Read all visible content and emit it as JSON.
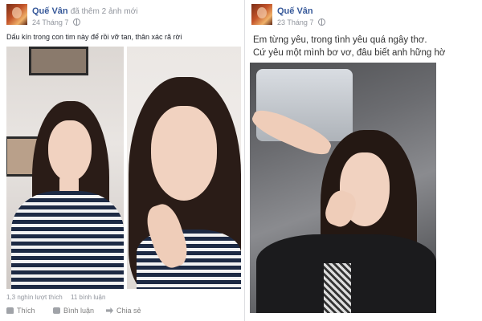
{
  "post_left": {
    "author": "Quế Vân",
    "extra_text": "đã thêm 2 ảnh mới",
    "date": "24 Tháng 7",
    "caption": "Dấu kín trong con tim này để rồi vỡ tan, thân xác rã rời",
    "counts": {
      "likes": "1,3 nghìn lượt thích",
      "comments": "11 bình luận"
    },
    "actions": {
      "like": "Thích",
      "comment": "Bình luận",
      "share": "Chia sẻ"
    }
  },
  "post_right": {
    "author": "Quế Vân",
    "date": "23 Tháng 7",
    "caption_lines": [
      "Em từng yêu, trong tình yêu quá ngây thơ.",
      "Cứ yêu một mình bơ vơ, đâu biết anh hững hờ"
    ]
  },
  "icons": [
    "globe-icon",
    "like-icon",
    "comment-icon",
    "share-icon"
  ],
  "colors": {
    "author_link": "#365899",
    "muted_text": "#90949c",
    "background": "#e9ebee"
  }
}
